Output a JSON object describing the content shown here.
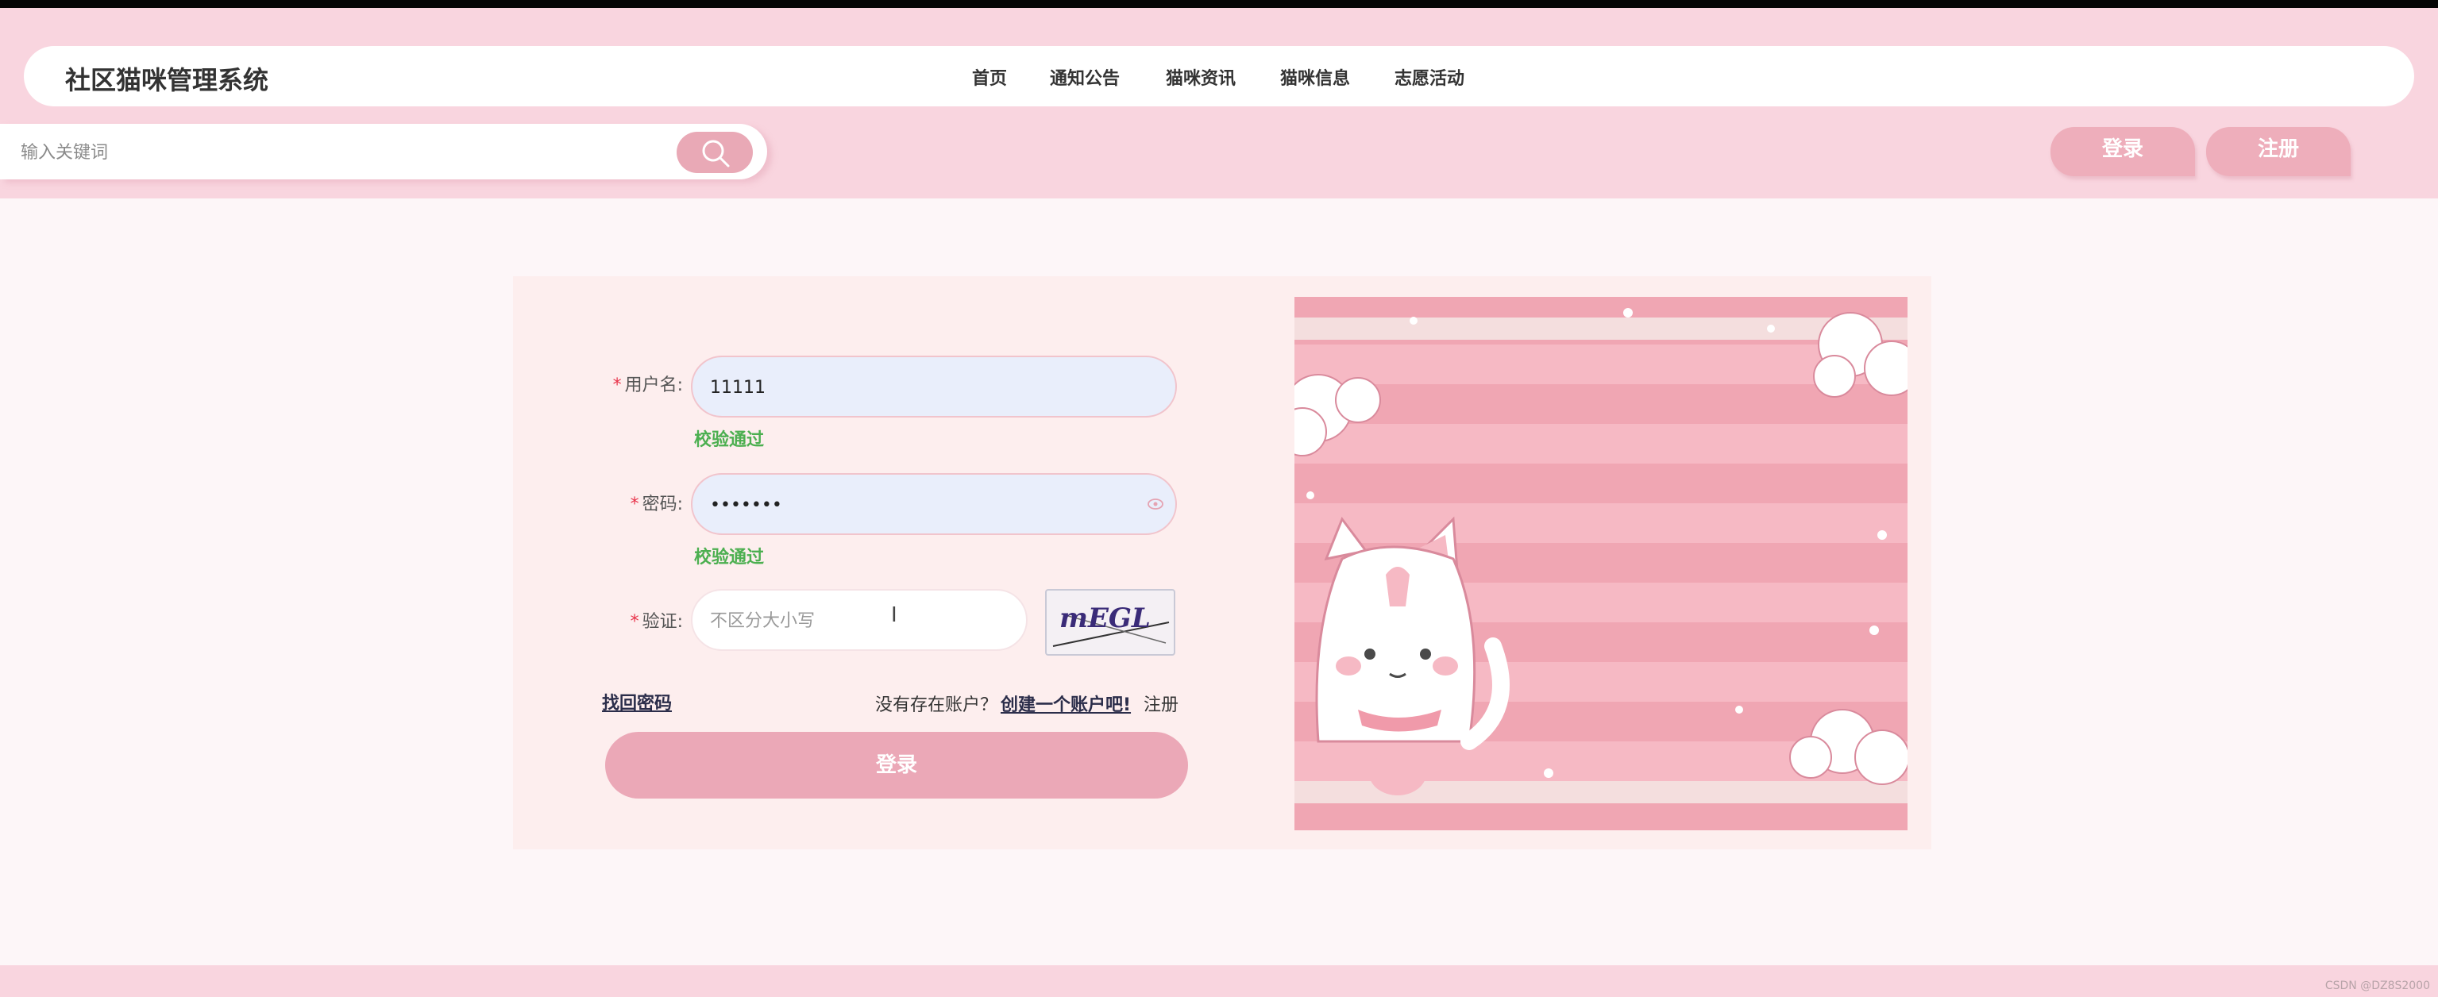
{
  "header": {
    "site_title": "社区猫咪管理系统",
    "nav": [
      "首页",
      "通知公告",
      "猫咪资讯",
      "猫咪信息",
      "志愿活动"
    ],
    "search_placeholder": "输入关键词",
    "login_label": "登录",
    "register_label": "注册"
  },
  "login_form": {
    "username_label": "用户名:",
    "username_value": "11111",
    "username_status": "校验通过",
    "password_label": "密码:",
    "password_value": "•••••••",
    "password_status": "校验通过",
    "captcha_label": "验证:",
    "captcha_placeholder": "不区分大小写",
    "captcha_text": "mEGL",
    "forgot_password": "找回密码",
    "no_account_text": "没有存在账户？",
    "create_account_link": "创建一个账户吧!",
    "register_text": "注册",
    "submit_label": "登录"
  },
  "watermark": "CSDN @DZ8S2000",
  "colors": {
    "header_bg": "#f9d5df",
    "accent_pink": "#eba8b7",
    "valid_green": "#4caf50",
    "required_red": "#e8334a"
  }
}
